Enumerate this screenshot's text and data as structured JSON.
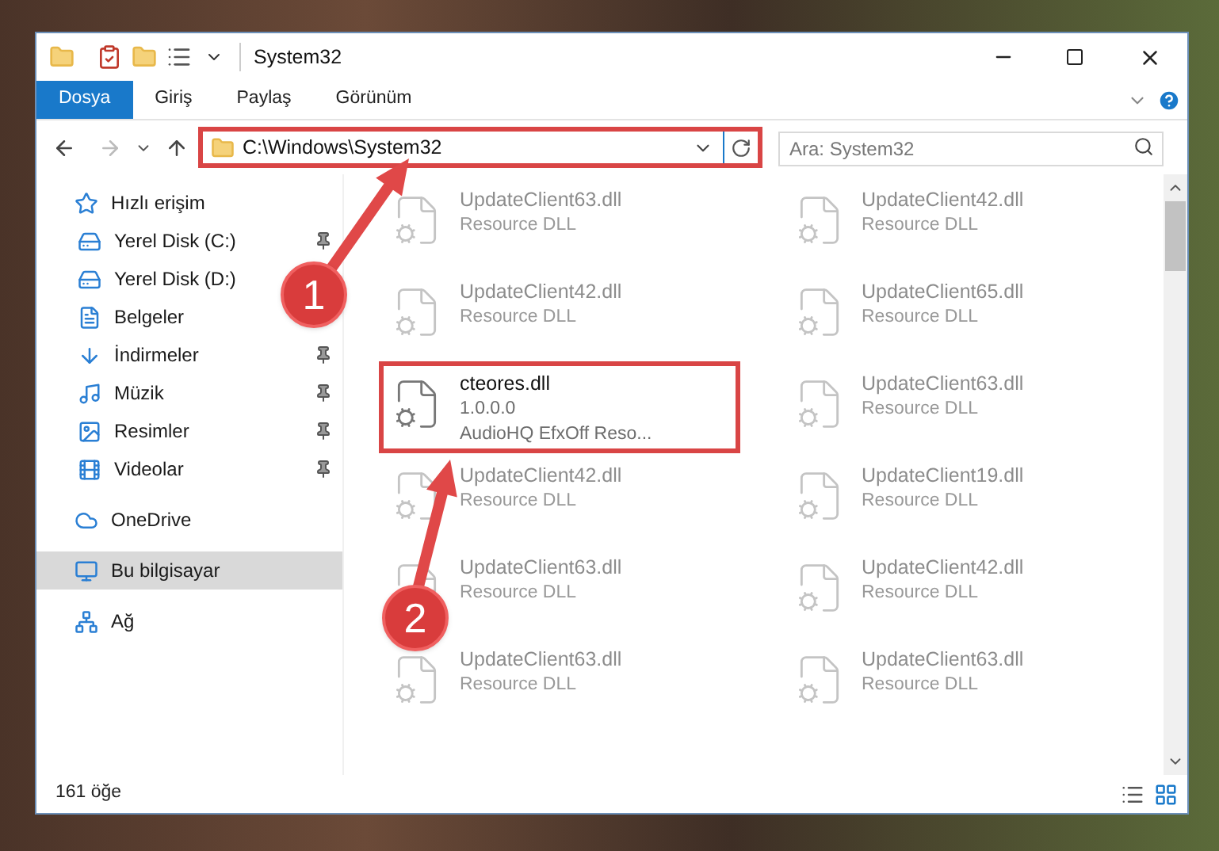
{
  "window": {
    "title": "System32"
  },
  "ribbon_tabs": [
    {
      "label": "Dosya",
      "selected": true
    },
    {
      "label": "Giriş",
      "selected": false
    },
    {
      "label": "Paylaş",
      "selected": false
    },
    {
      "label": "Görünüm",
      "selected": false
    }
  ],
  "address": {
    "value": "C:\\Windows\\System32",
    "highlighted": true
  },
  "search": {
    "placeholder": "Ara: System32"
  },
  "sidebar": {
    "items": [
      {
        "label": "Hızlı erişim",
        "kind": "star",
        "selected": false,
        "children": [
          {
            "label": "Yerel Disk (C:)",
            "kind": "drive",
            "pinned": true
          },
          {
            "label": "Yerel Disk (D:)",
            "kind": "drive",
            "pinned": false
          },
          {
            "label": "Belgeler",
            "kind": "doc",
            "pinned": false
          },
          {
            "label": "İndirmeler",
            "kind": "download",
            "pinned": true
          },
          {
            "label": "Müzik",
            "kind": "music",
            "pinned": true
          },
          {
            "label": "Resimler",
            "kind": "image",
            "pinned": true
          },
          {
            "label": "Videolar",
            "kind": "film",
            "pinned": true
          }
        ]
      },
      {
        "label": "OneDrive",
        "kind": "cloud",
        "selected": false
      },
      {
        "label": "Bu bilgisayar",
        "kind": "pc",
        "selected": true
      },
      {
        "label": "Ağ",
        "kind": "network",
        "selected": false
      }
    ]
  },
  "files": [
    {
      "name": "UpdateClient63.dll",
      "details": [
        "Resource DLL"
      ],
      "blurred": true,
      "highlighted": false
    },
    {
      "name": "UpdateClient42.dll",
      "details": [
        "Resource DLL"
      ],
      "blurred": true,
      "highlighted": false
    },
    {
      "name": "UpdateClient42.dll",
      "details": [
        "Resource DLL"
      ],
      "blurred": true,
      "highlighted": false
    },
    {
      "name": "UpdateClient65.dll",
      "details": [
        "Resource DLL"
      ],
      "blurred": true,
      "highlighted": false
    },
    {
      "name": "cteores.dll",
      "details": [
        "1.0.0.0",
        "AudioHQ EfxOff Reso..."
      ],
      "blurred": false,
      "highlighted": true
    },
    {
      "name": "UpdateClient63.dll",
      "details": [
        "Resource DLL"
      ],
      "blurred": true,
      "highlighted": false
    },
    {
      "name": "UpdateClient42.dll",
      "details": [
        "Resource DLL"
      ],
      "blurred": true,
      "highlighted": false
    },
    {
      "name": "UpdateClient19.dll",
      "details": [
        "Resource DLL"
      ],
      "blurred": true,
      "highlighted": false
    },
    {
      "name": "UpdateClient63.dll",
      "details": [
        "Resource DLL"
      ],
      "blurred": true,
      "highlighted": false
    },
    {
      "name": "UpdateClient42.dll",
      "details": [
        "Resource DLL"
      ],
      "blurred": true,
      "highlighted": false
    },
    {
      "name": "UpdateClient63.dll",
      "details": [
        "Resource DLL"
      ],
      "blurred": true,
      "highlighted": false
    },
    {
      "name": "UpdateClient63.dll",
      "details": [
        "Resource DLL"
      ],
      "blurred": true,
      "highlighted": false
    }
  ],
  "status_bar": {
    "count": "161 öğe"
  },
  "annotations": [
    {
      "label": "1"
    },
    {
      "label": "2"
    }
  ]
}
